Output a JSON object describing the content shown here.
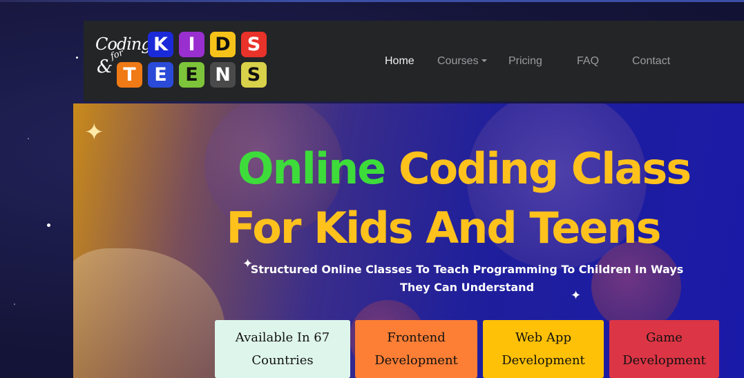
{
  "logo": {
    "coding": "Coding",
    "amp": "&",
    "for": "for",
    "kids_letters": [
      "K",
      "I",
      "D",
      "S"
    ],
    "teens_letters": [
      "T",
      "E",
      "E",
      "N",
      "S"
    ],
    "kids_colors": [
      "#1b2ad8",
      "#9a2fd0",
      "#f6c21a",
      "#e8322a"
    ],
    "teens_colors": [
      "#f07a16",
      "#2a4ad8",
      "#7ec43a",
      "#4a4a4a",
      "#d8d14a"
    ]
  },
  "nav": {
    "home": "Home",
    "courses": "Courses",
    "pricing": "Pricing",
    "faq": "FAQ",
    "contact": "Contact"
  },
  "hero": {
    "title_green": "Online",
    "title_yellow_1": "Coding Class",
    "title_line2": "For Kids And Teens",
    "subtitle": "Structured Online Classes To Teach Programming To Children In Ways They Can Understand"
  },
  "cards": [
    {
      "label": "Available In 67 Countries",
      "color": "#def5ec"
    },
    {
      "label": "Frontend Development",
      "color": "#fd7e35"
    },
    {
      "label": "Web App Development",
      "color": "#ffc107"
    },
    {
      "label": "Game Development",
      "color": "#dc3545"
    }
  ]
}
